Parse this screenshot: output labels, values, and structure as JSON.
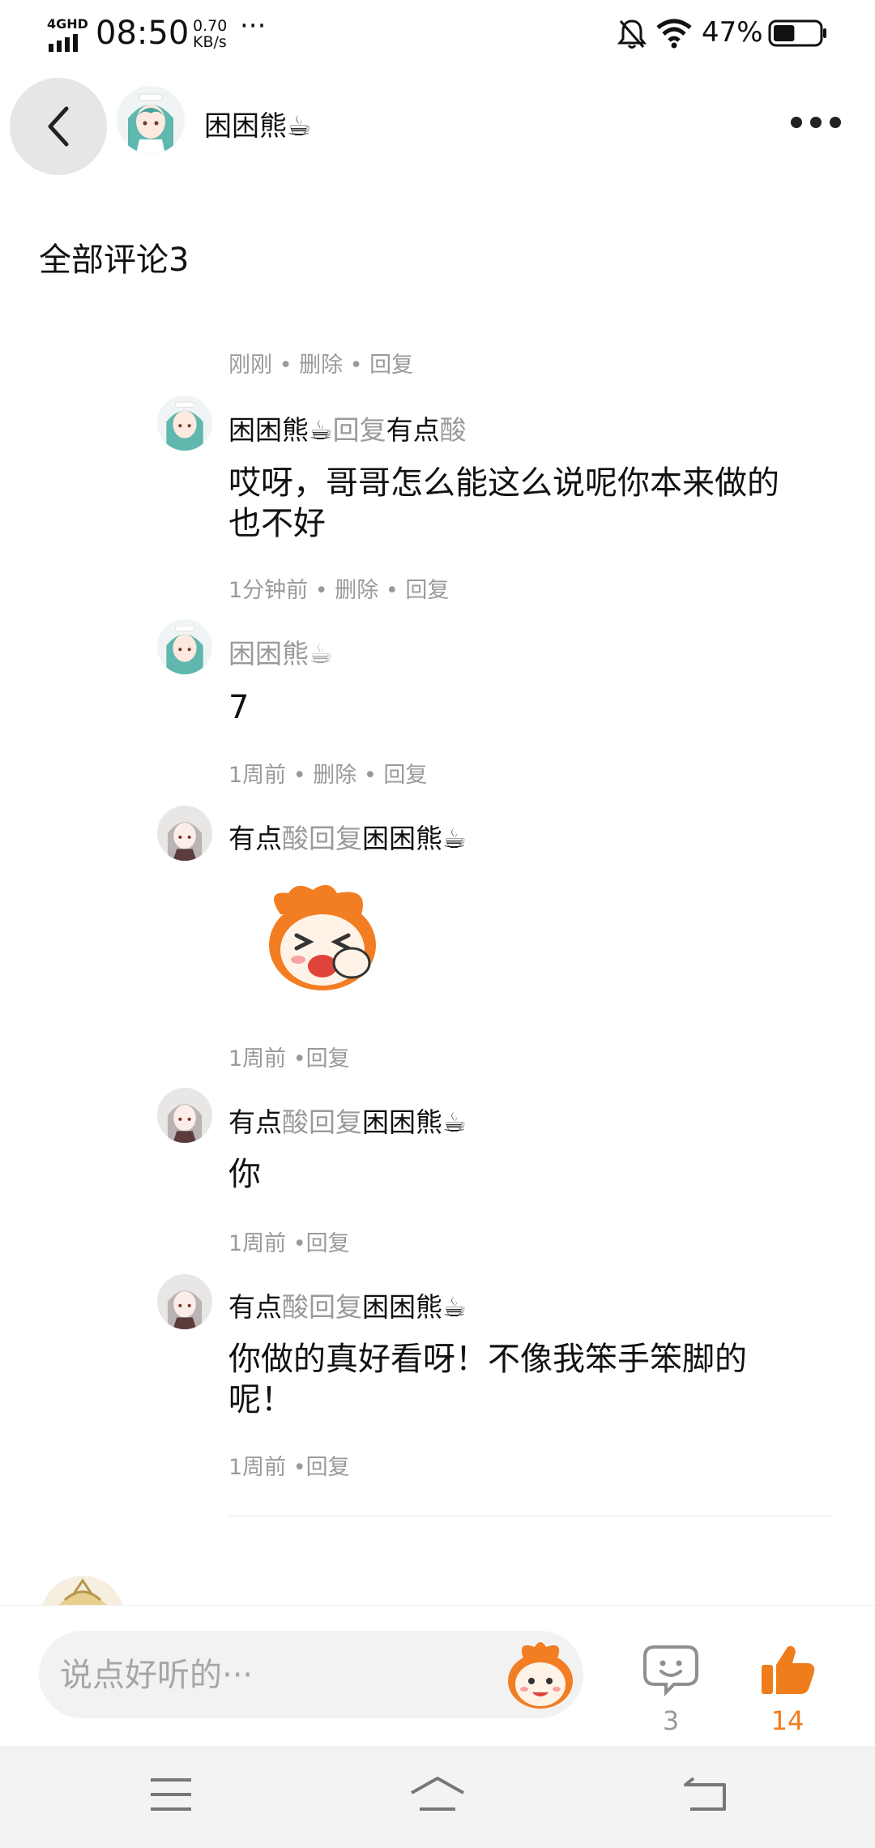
{
  "status_bar": {
    "network": "4GHD",
    "time": "08:50",
    "speed_value": "0.70",
    "speed_unit": "KB/s",
    "more": "···",
    "battery": "47%",
    "battery_level": 0.47
  },
  "header": {
    "user_name": "困困熊☕"
  },
  "section_title": "全部评论3",
  "comments": [
    {
      "meta": "刚刚 • 删除 • 回复"
    },
    {
      "author": "困困熊☕",
      "reply_word": "回复",
      "target_a": "有点",
      "target_b": "酸",
      "text": "哎呀，哥哥怎么能这么说呢你本来做的也不好",
      "meta": "1分钟前 • 删除 • 回复"
    },
    {
      "author": "困困熊☕",
      "text": "7",
      "meta": "1周前 • 删除 • 回复"
    },
    {
      "author_a": "有点",
      "author_b": "酸",
      "reply_word": "回复",
      "target": "困困熊☕",
      "meta": "1周前 •回复"
    },
    {
      "author_a": "有点",
      "author_b": "酸",
      "reply_word": "回复",
      "target": "困困熊☕",
      "text": "你",
      "meta": "1周前 •回复"
    },
    {
      "author_a": "有点",
      "author_b": "酸",
      "reply_word": "回复",
      "target": "困困熊☕",
      "text_line1": "你做的真好看呀！不像我笨手笨脚的",
      "text_line2": "呢！",
      "meta": "1周前 •回复"
    }
  ],
  "input_bar": {
    "placeholder": "说点好听的···",
    "comment_count": "3",
    "like_count": "14",
    "like_color": "#f07d1b"
  }
}
